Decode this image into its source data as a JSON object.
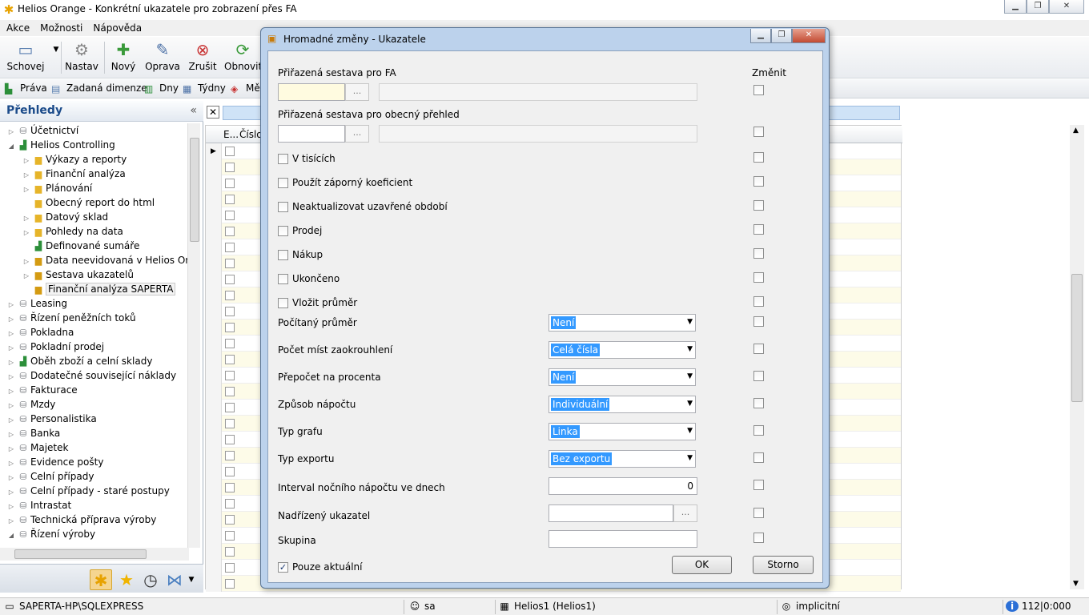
{
  "window": {
    "title": "Helios Orange - Konkrétní ukazatele pro zobrazení přes FA"
  },
  "menu": [
    "Akce",
    "Možnosti",
    "Nápověda"
  ],
  "toolbar": {
    "buttons": [
      {
        "label": "Schovej",
        "icon": "save-icon"
      },
      {
        "label": "Nastav",
        "icon": "settings-icon"
      },
      {
        "label": "Nový",
        "icon": "new-document-icon"
      },
      {
        "label": "Oprava",
        "icon": "edit-icon"
      },
      {
        "label": "Zrušit",
        "icon": "delete-icon"
      },
      {
        "label": "Obnovit",
        "icon": "refresh-icon"
      }
    ]
  },
  "toolbar2": {
    "items": [
      {
        "label": "Práva",
        "icon": "rights-icon"
      },
      {
        "label": "Zadaná dimenze",
        "icon": "dimension-icon"
      },
      {
        "label": "Dny",
        "icon": "days-icon"
      },
      {
        "label": "Týdny",
        "icon": "weeks-icon"
      },
      {
        "label": "Mě",
        "icon": "months-icon"
      }
    ]
  },
  "left_panel": {
    "title": "Přehledy",
    "collapse_glyph": "«",
    "tree": [
      {
        "label": "Účetnictví",
        "level": 0,
        "icon": "db",
        "expanded": false
      },
      {
        "label": "Helios Controlling",
        "level": 0,
        "icon": "chart",
        "expanded": true
      },
      {
        "label": "Výkazy a reporty",
        "level": 1,
        "icon": "folder",
        "expanded": false
      },
      {
        "label": "Finanční analýza",
        "level": 1,
        "icon": "folder",
        "expanded": false
      },
      {
        "label": "Plánování",
        "level": 1,
        "icon": "folder",
        "expanded": false
      },
      {
        "label": "Obecný report do html",
        "level": 1,
        "icon": "folder",
        "expanded": null
      },
      {
        "label": "Datový sklad",
        "level": 1,
        "icon": "folder",
        "expanded": false
      },
      {
        "label": "Pohledy na data",
        "level": 1,
        "icon": "folder",
        "expanded": false
      },
      {
        "label": "Definované sumáře",
        "level": 1,
        "icon": "chart",
        "expanded": null
      },
      {
        "label": "Data neevidovaná v Helios Oran",
        "level": 1,
        "icon": "lock",
        "expanded": false
      },
      {
        "label": "Sestava ukazatelů",
        "level": 1,
        "icon": "lock",
        "expanded": false
      },
      {
        "label": "Finanční analýza SAPERTA",
        "level": 1,
        "icon": "lock",
        "expanded": null,
        "selected": true
      },
      {
        "label": "Leasing",
        "level": 0,
        "icon": "db",
        "expanded": false
      },
      {
        "label": "Řízení peněžních toků",
        "level": 0,
        "icon": "db",
        "expanded": false
      },
      {
        "label": "Pokladna",
        "level": 0,
        "icon": "db",
        "expanded": false
      },
      {
        "label": "Pokladní prodej",
        "level": 0,
        "icon": "db",
        "expanded": false
      },
      {
        "label": "Oběh zboží a celní sklady",
        "level": 0,
        "icon": "chart",
        "expanded": false
      },
      {
        "label": "Dodatečné související náklady",
        "level": 0,
        "icon": "db",
        "expanded": false
      },
      {
        "label": "Fakturace",
        "level": 0,
        "icon": "db",
        "expanded": false
      },
      {
        "label": "Mzdy",
        "level": 0,
        "icon": "db",
        "expanded": false
      },
      {
        "label": "Personalistika",
        "level": 0,
        "icon": "db",
        "expanded": false
      },
      {
        "label": "Banka",
        "level": 0,
        "icon": "db",
        "expanded": false
      },
      {
        "label": "Majetek",
        "level": 0,
        "icon": "db",
        "expanded": false
      },
      {
        "label": "Evidence pošty",
        "level": 0,
        "icon": "db",
        "expanded": false
      },
      {
        "label": "Celní případy",
        "level": 0,
        "icon": "db",
        "expanded": false
      },
      {
        "label": "Celní případy - staré postupy",
        "level": 0,
        "icon": "db",
        "expanded": false
      },
      {
        "label": "Intrastat",
        "level": 0,
        "icon": "db",
        "expanded": false
      },
      {
        "label": "Technická příprava výroby",
        "level": 0,
        "icon": "db",
        "expanded": false
      },
      {
        "label": "Řízení výroby",
        "level": 0,
        "icon": "db",
        "expanded": true
      }
    ],
    "bottom_icons": [
      "helios-logo-icon",
      "favorites-star-icon",
      "history-clock-icon",
      "share-icon"
    ]
  },
  "grid": {
    "header": {
      "col1": "E...",
      "col2": "Číslo"
    },
    "row_count": 28
  },
  "status": {
    "server": "SAPERTA-HP\\SQLEXPRESS",
    "user": "sa",
    "database": "Helios1 (Helios1)",
    "mode": "implicitní",
    "info": "112|0:000"
  },
  "dialog": {
    "title": "Hromadné změny - Ukazatele",
    "change_header": "Změnit",
    "assigned_report_fa_label": "Přiřazená sestava pro FA",
    "assigned_report_general_label": "Přiřazená sestava pro obecný přehled",
    "ellipsis": "...",
    "checkboxes": [
      {
        "label": "V tisících",
        "checked": false
      },
      {
        "label": "Použít záporný koeficient",
        "checked": false
      },
      {
        "label": "Neaktualizovat uzavřené období",
        "checked": false
      },
      {
        "label": "Prodej",
        "checked": false
      },
      {
        "label": "Nákup",
        "checked": false
      },
      {
        "label": "Ukončeno",
        "checked": false
      },
      {
        "label": "Vložit průměr",
        "checked": false
      }
    ],
    "combos": [
      {
        "label": "Počítaný průměr",
        "value": "Není"
      },
      {
        "label": "Počet míst zaokrouhlení",
        "value": "Celá čísla"
      },
      {
        "label": "Přepočet na procenta",
        "value": "Není"
      },
      {
        "label": "Způsob nápočtu",
        "value": "Individuální"
      },
      {
        "label": "Typ grafu",
        "value": "Linka"
      },
      {
        "label": "Typ exportu",
        "value": "Bez exportu"
      }
    ],
    "night_interval_label": "Interval nočního nápočtu ve dnech",
    "night_interval_value": "0",
    "parent_indicator_label": "Nadřízený ukazatel",
    "group_label": "Skupina",
    "only_current_label": "Pouze aktuální",
    "only_current_checked": true,
    "ok_label": "OK",
    "cancel_label": "Storno"
  }
}
